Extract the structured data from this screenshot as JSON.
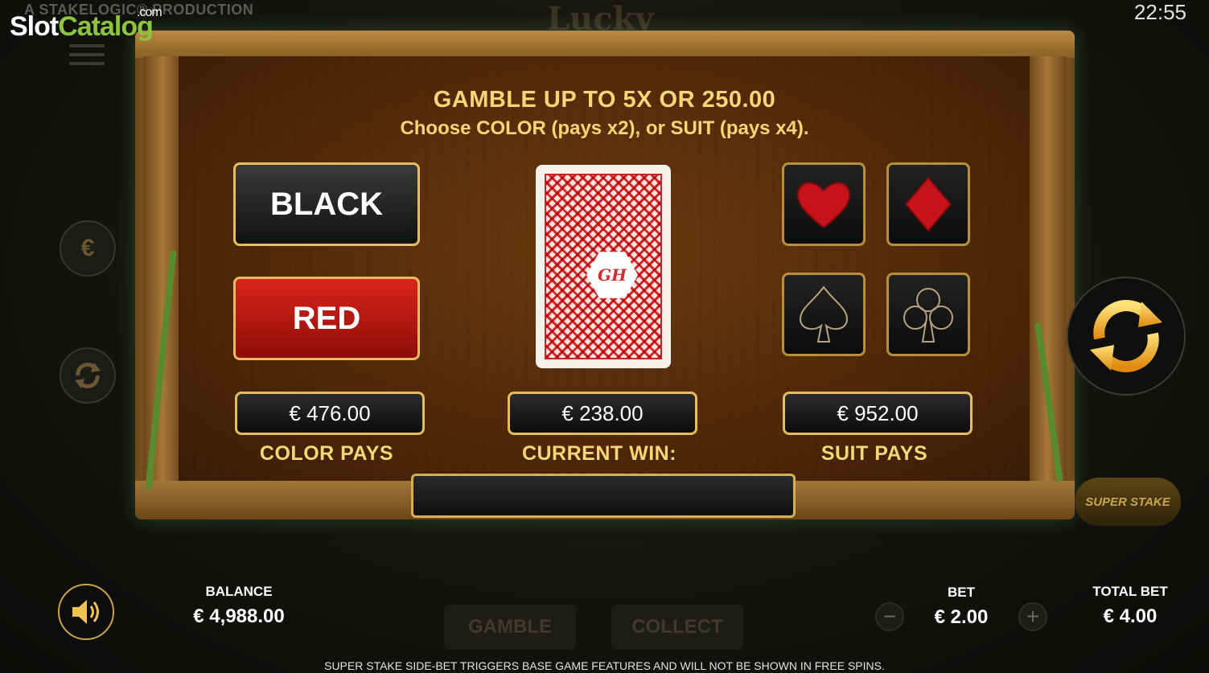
{
  "header": {
    "producer": "A STAKELOGIC® PRODUCTION",
    "watermark_part1": "Slot",
    "watermark_part2": "Catalog",
    "watermark_suffix": ".com",
    "clock": "22:55",
    "game_logo": "Lucky"
  },
  "gamble": {
    "title": "GAMBLE UP TO 5X OR  250.00",
    "subtitle": "Choose COLOR (pays x2), or SUIT (pays x4).",
    "black_label": "BLACK",
    "red_label": "RED",
    "card_logo": "GH",
    "color_pays_value": "€ 476.00",
    "color_pays_label": "COLOR PAYS",
    "current_win_value": "€ 238.00",
    "current_win_label": "CURRENT WIN:",
    "suit_pays_value": "€ 952.00",
    "suit_pays_label": "SUIT PAYS",
    "suits": [
      "heart",
      "diamond",
      "spade",
      "club"
    ]
  },
  "side": {
    "superstake_label": "SUPER STAKE"
  },
  "bottom": {
    "balance_label": "BALANCE",
    "balance_value": "€ 4,988.00",
    "gamble_button": "GAMBLE",
    "collect_button": "COLLECT",
    "bet_label": "BET",
    "bet_value": "€ 2.00",
    "minus": "−",
    "plus": "+",
    "total_bet_label": "TOTAL BET",
    "total_bet_value": "€ 4.00",
    "footer_text": "SUPER STAKE SIDE-BET TRIGGERS BASE GAME FEATURES AND WILL NOT BE SHOWN IN FREE SPINS."
  },
  "colors": {
    "gold": "#f7d676",
    "border_gold": "#e6bd5a",
    "red": "#d8241c",
    "watermark_green": "#8ec33f"
  }
}
